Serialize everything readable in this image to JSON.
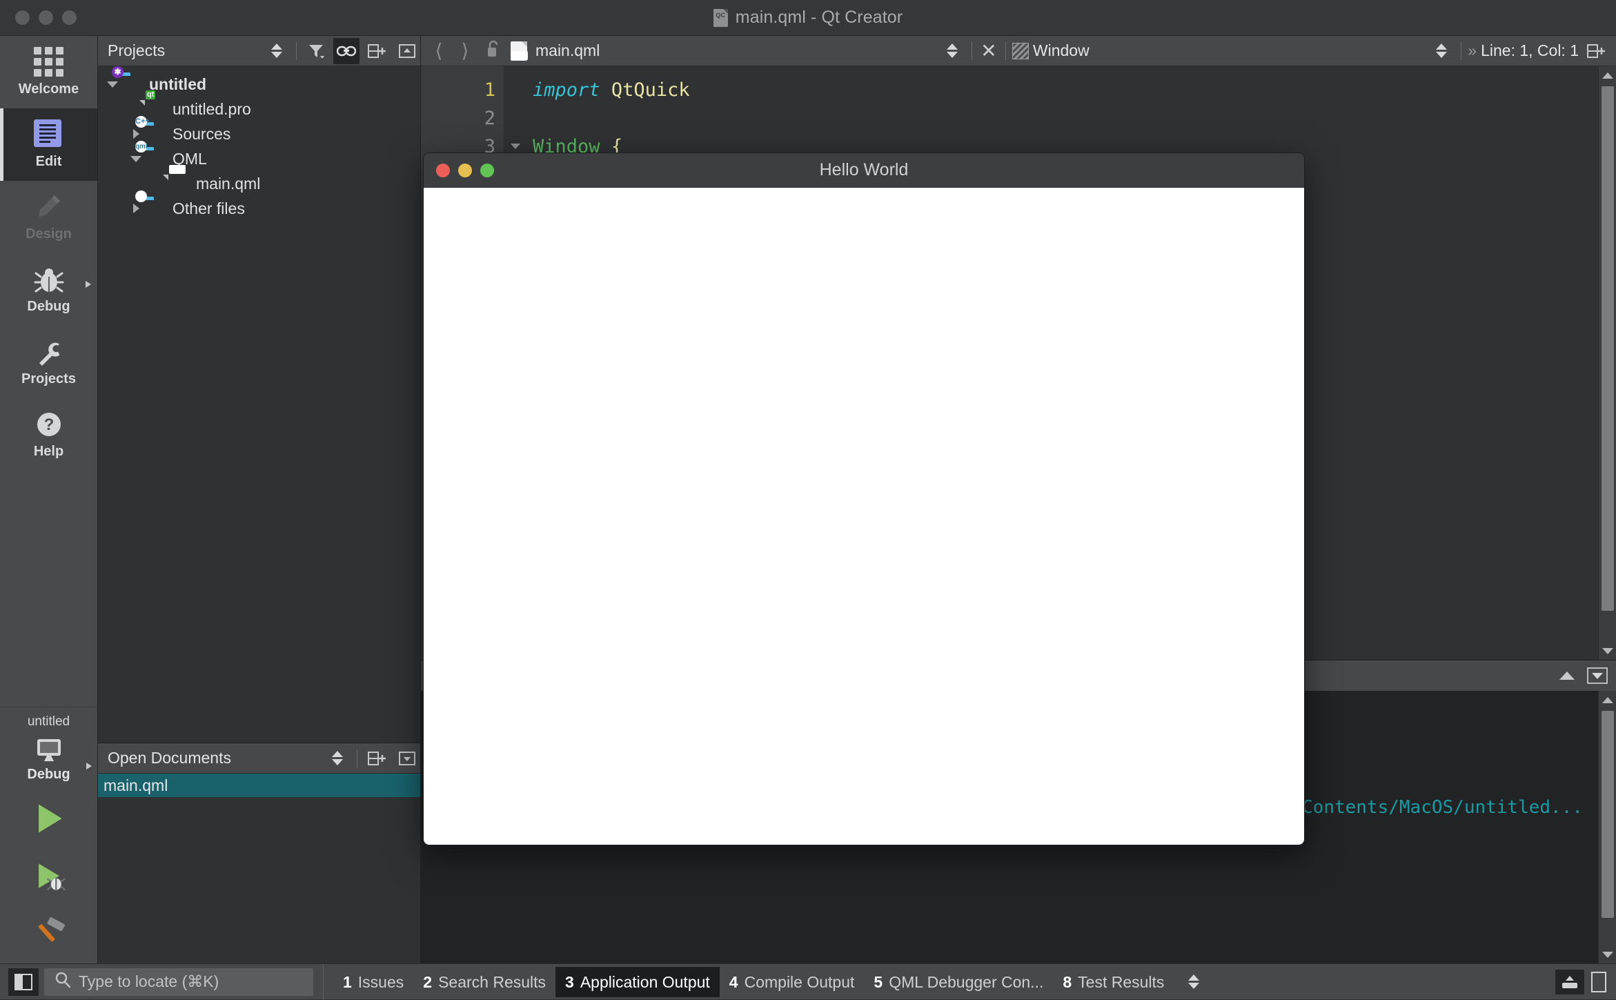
{
  "window": {
    "title": "main.qml - Qt Creator",
    "doc_icon": "qt-creator-document-icon"
  },
  "modebar": {
    "items": [
      {
        "label": "Welcome",
        "icon": "grid-icon",
        "state": "normal"
      },
      {
        "label": "Edit",
        "icon": "edit-lines-icon",
        "state": "active"
      },
      {
        "label": "Design",
        "icon": "pencil-icon",
        "state": "disabled"
      },
      {
        "label": "Debug",
        "icon": "bug-icon",
        "state": "normal",
        "has_arrow": true
      },
      {
        "label": "Projects",
        "icon": "wrench-icon",
        "state": "normal"
      },
      {
        "label": "Help",
        "icon": "question-mark-icon",
        "state": "normal"
      }
    ],
    "kit": {
      "project_name": "untitled",
      "build_config": "Debug",
      "target_icon": "desktop-monitor-icon",
      "run_label": "run-button",
      "debug_label": "run-debug-button",
      "build_label": "build-hammer-button"
    }
  },
  "projects_panel": {
    "title": "Projects",
    "toolbar": [
      {
        "name": "filter-icon",
        "active": false
      },
      {
        "name": "link-sync-icon",
        "active": true
      },
      {
        "name": "split-add-icon",
        "active": false
      },
      {
        "name": "close-panel-icon",
        "active": false
      }
    ],
    "tree": [
      {
        "label": "untitled",
        "indent": 0,
        "twisty": "down",
        "icon": "folder-project-icon",
        "bold": true
      },
      {
        "label": "untitled.pro",
        "indent": 1,
        "twisty": "none",
        "icon": "qt-pro-file-icon",
        "bold": false
      },
      {
        "label": "Sources",
        "indent": 1,
        "twisty": "right",
        "icon": "folder-cpp-icon",
        "bold": false
      },
      {
        "label": "QML",
        "indent": 1,
        "twisty": "down",
        "icon": "folder-qml-icon",
        "bold": false
      },
      {
        "label": "main.qml",
        "indent": 2,
        "twisty": "none",
        "icon": "qml-file-icon",
        "bold": false
      },
      {
        "label": "Other files",
        "indent": 1,
        "twisty": "right",
        "icon": "folder-other-icon",
        "bold": false
      }
    ]
  },
  "open_documents": {
    "title": "Open Documents",
    "toolbar": [
      {
        "name": "split-add-icon",
        "active": false
      },
      {
        "name": "close-panel-icon",
        "active": false
      }
    ],
    "items": [
      {
        "label": "main.qml",
        "selected": true
      }
    ]
  },
  "editor": {
    "toolbar": {
      "back_icon": "chevron-left-icon",
      "forward_icon": "chevron-right-icon",
      "lock_icon": "unlocked-padlock-icon",
      "file_icon": "qml-file-icon",
      "file_name": "main.qml",
      "close_icon": "close-document-icon",
      "symbol_icon": "window-element-icon",
      "symbol_name": "Window",
      "overflow_icon": "double-chevron-right-icon",
      "cursor_position": "Line: 1, Col: 1",
      "split_icon": "split-add-icon"
    },
    "lines": [
      {
        "number": "1",
        "current": true,
        "fold": false,
        "tokens": [
          {
            "text": "import",
            "style": "kw-import"
          },
          {
            "text": " ",
            "style": "plain"
          },
          {
            "text": "QtQuick",
            "style": "tok-module"
          }
        ]
      },
      {
        "number": "2",
        "current": false,
        "fold": false,
        "tokens": []
      },
      {
        "number": "3",
        "current": false,
        "fold": true,
        "tokens": [
          {
            "text": "Window",
            "style": "tok-type"
          },
          {
            "text": " ",
            "style": "plain"
          },
          {
            "text": "{",
            "style": "tok-punct"
          }
        ]
      }
    ]
  },
  "output_pane": {
    "header_icons": [
      {
        "name": "collapse-chevron-up-icon"
      },
      {
        "name": "maximize-output-icon"
      }
    ],
    "lines": [
      "/Contents/MacOS/untitled..."
    ]
  },
  "statusbar": {
    "sidebar_toggle_icon": "toggle-left-sidebar-icon",
    "locator": {
      "icon": "search-icon",
      "placeholder": "Type to locate (⌘K)",
      "value": ""
    },
    "tabs": [
      {
        "num": "1",
        "label": "Issues",
        "active": false
      },
      {
        "num": "2",
        "label": "Search Results",
        "active": false
      },
      {
        "num": "3",
        "label": "Application Output",
        "active": true
      },
      {
        "num": "4",
        "label": "Compile Output",
        "active": false
      },
      {
        "num": "5",
        "label": "QML Debugger Con...",
        "active": false
      },
      {
        "num": "8",
        "label": "Test Results",
        "active": false
      }
    ],
    "tabs_spinner_icon": "updown-spinner-icon",
    "right_icons": [
      {
        "name": "zoom-slider-icon"
      },
      {
        "name": "toggle-right-sidebar-icon"
      }
    ]
  },
  "hello_window": {
    "title": "Hello World",
    "lights": [
      {
        "name": "close-button",
        "color": "#eb5f57"
      },
      {
        "name": "minimize-button",
        "color": "#e5c050"
      },
      {
        "name": "maximize-button",
        "color": "#62c454"
      }
    ]
  },
  "colors": {
    "accent_selection": "#19616b",
    "edit_mode_icon": "#919ae8",
    "output_text": "#1a9aa2",
    "code_keyword": "#37c3d4",
    "code_type": "#5ab860",
    "code_module": "#e8e4a8",
    "current_line_number": "#d6c24a"
  }
}
